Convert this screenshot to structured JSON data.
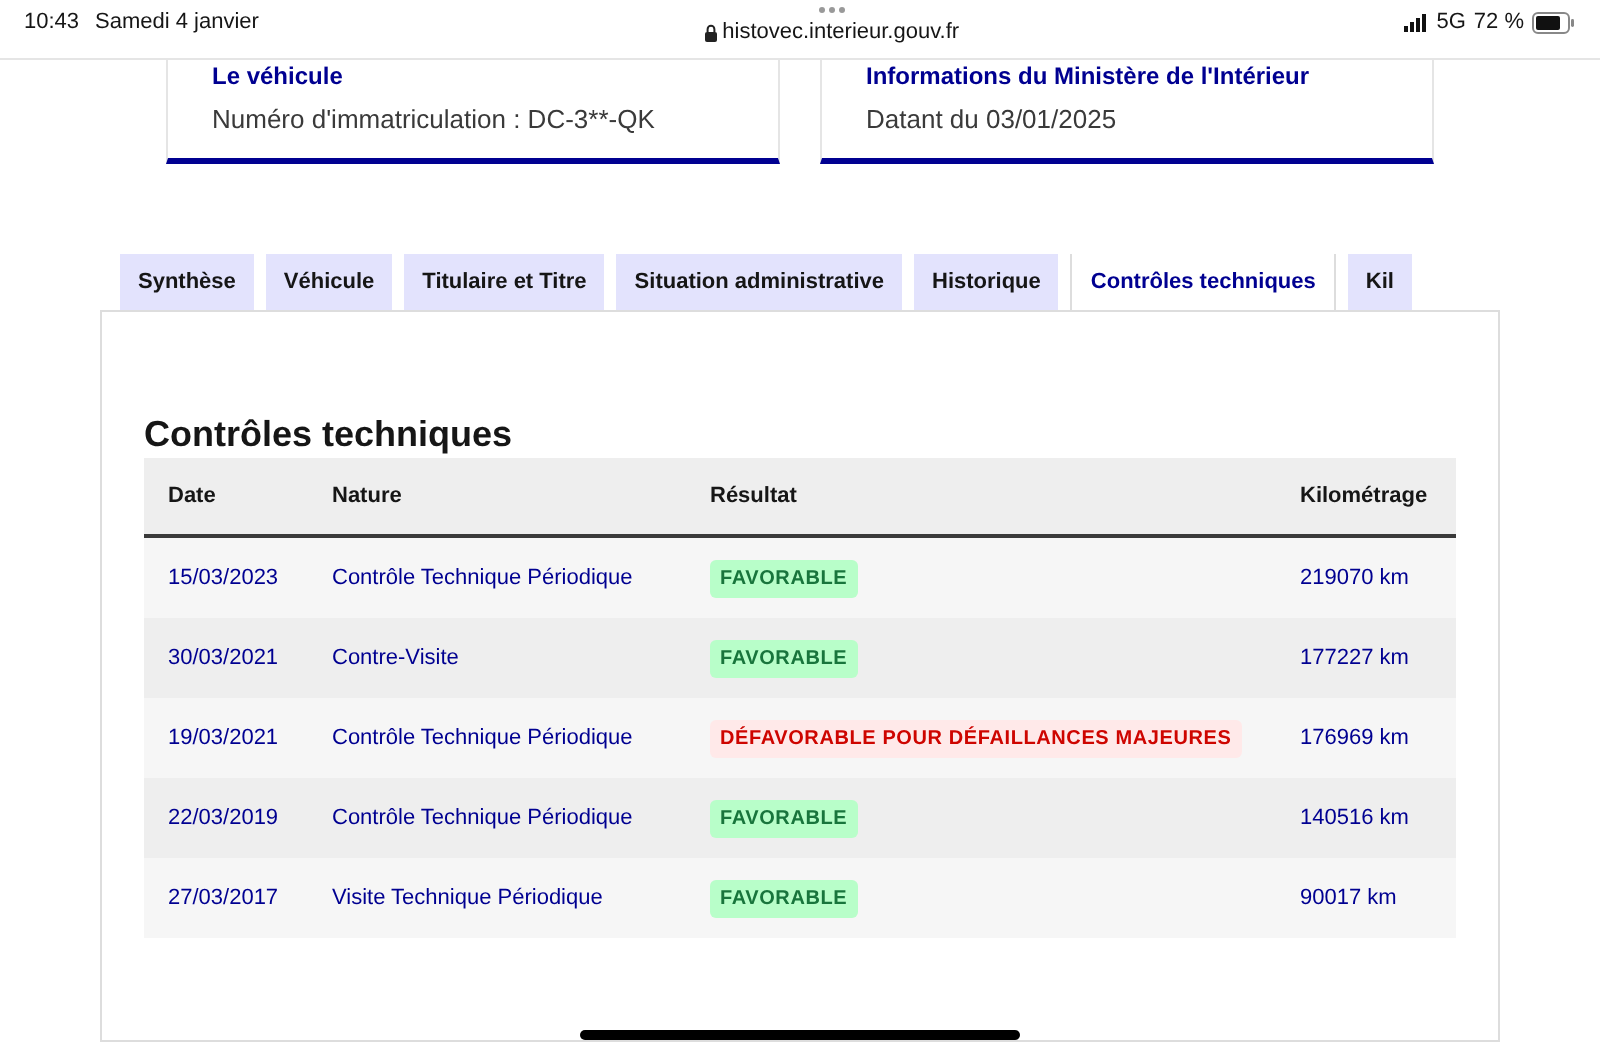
{
  "status_bar": {
    "time": "10:43",
    "date": "Samedi 4 janvier",
    "url": "histovec.interieur.gouv.fr",
    "network": "5G",
    "battery": "72 %"
  },
  "cards": [
    {
      "title": "Le véhicule",
      "text": "Numéro d'immatriculation : DC-3**-QK"
    },
    {
      "title": "Informations du Ministère de l'Intérieur",
      "text": "Datant du 03/01/2025"
    }
  ],
  "tabs": [
    {
      "label": "Synthèse",
      "selected": false
    },
    {
      "label": "Véhicule",
      "selected": false
    },
    {
      "label": "Titulaire et Titre",
      "selected": false
    },
    {
      "label": "Situation administrative",
      "selected": false
    },
    {
      "label": "Historique",
      "selected": false
    },
    {
      "label": "Contrôles techniques",
      "selected": true
    },
    {
      "label": "Kil",
      "selected": false
    }
  ],
  "section_title": "Contrôles techniques",
  "table": {
    "columns": [
      "Date",
      "Nature",
      "Résultat",
      "Kilométrage"
    ],
    "rows": [
      {
        "date": "15/03/2023",
        "nature": "Contrôle Technique Périodique",
        "result": {
          "label": "FAVORABLE",
          "kind": "success"
        },
        "km": "219070 km"
      },
      {
        "date": "30/03/2021",
        "nature": "Contre-Visite",
        "result": {
          "label": "FAVORABLE",
          "kind": "success"
        },
        "km": "177227 km"
      },
      {
        "date": "19/03/2021",
        "nature": "Contrôle Technique Périodique",
        "result": {
          "label": "DÉFAVORABLE POUR DÉFAILLANCES MAJEURES",
          "kind": "error"
        },
        "km": "176969 km"
      },
      {
        "date": "22/03/2019",
        "nature": "Contrôle Technique Périodique",
        "result": {
          "label": "FAVORABLE",
          "kind": "success"
        },
        "km": "140516 km"
      },
      {
        "date": "27/03/2017",
        "nature": "Visite Technique Périodique",
        "result": {
          "label": "FAVORABLE",
          "kind": "success"
        },
        "km": "90017 km"
      }
    ]
  }
}
